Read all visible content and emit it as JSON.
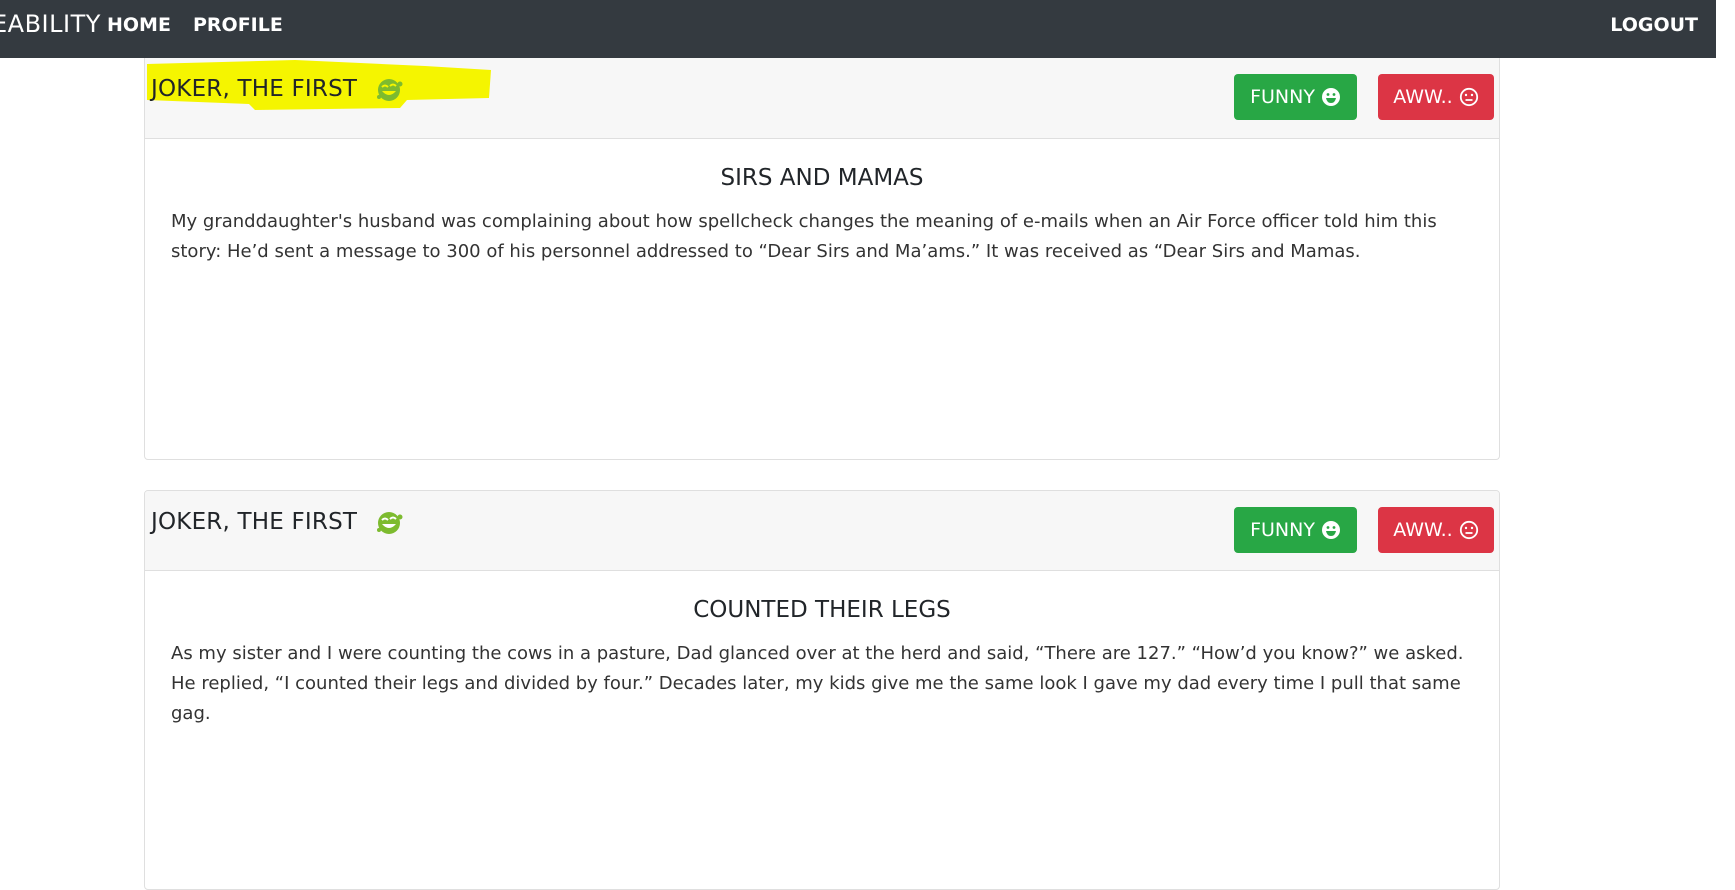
{
  "navbar": {
    "brand": "EABILITY",
    "home_label": "HOME",
    "profile_label": "PROFILE",
    "logout_label": "LOGOUT"
  },
  "colors": {
    "navbar_bg": "#343a40",
    "funny_green": "#28a745",
    "aww_red": "#dc3545",
    "highlight_yellow": "#f5f500",
    "author_icon_green": "#7dbb2f"
  },
  "posts": [
    {
      "author": "JOKER, THE FIRST",
      "author_icon": "laughing-face-icon",
      "highlighted": true,
      "funny_label": "FUNNY",
      "funny_icon": "grinning-face-icon",
      "aww_label": "AWW..",
      "aww_icon": "neutral-face-icon",
      "title": "SIRS AND MAMAS",
      "text": "My granddaughter's husband was complaining about how spellcheck changes the meaning of e-mails when an Air Force officer told him this story: He’d sent a message to 300 of his personnel addressed to “Dear Sirs and Ma’ams.” It was received as “Dear Sirs and Mamas."
    },
    {
      "author": "JOKER, THE FIRST",
      "author_icon": "laughing-face-icon",
      "highlighted": false,
      "funny_label": "FUNNY",
      "funny_icon": "grinning-face-icon",
      "aww_label": "AWW..",
      "aww_icon": "neutral-face-icon",
      "title": "COUNTED THEIR LEGS",
      "text": "As my sister and I were counting the cows in a pasture, Dad glanced over at the herd and said, “There are 127.” “How’d you know?” we asked. He replied, “I counted their legs and divided by four.” Decades later, my kids give me the same look I gave my dad every time I pull that same gag."
    }
  ]
}
